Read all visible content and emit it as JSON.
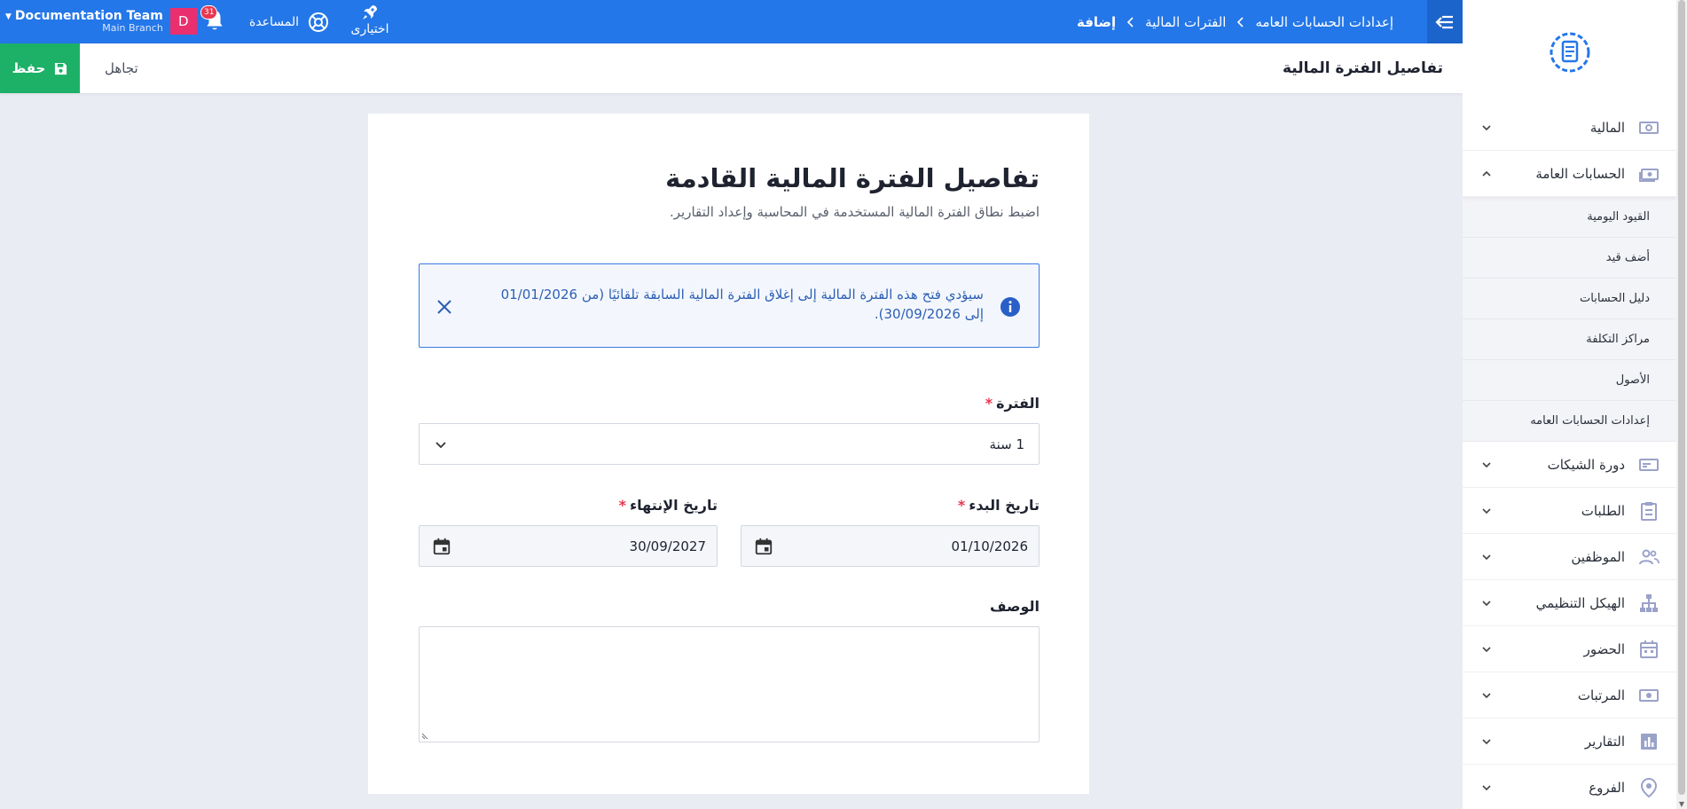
{
  "topbar": {
    "breadcrumb": [
      "إعدادات الحسابات العامه",
      "الفترات المالية",
      "إضافة"
    ],
    "shortcuts_label": "اختيارى",
    "help_label": "المساعدة",
    "notifications_count": "31",
    "user": {
      "team": "Documentation Team",
      "branch": "Main Branch",
      "avatar_letter": "D"
    }
  },
  "page": {
    "title": "تفاصيل الفترة المالية",
    "save_label": "حفظ",
    "cancel_label": "تجاهل"
  },
  "form": {
    "title": "تفاصيل الفترة المالية القادمة",
    "subtitle": "اضبط نطاق الفترة المالية المستخدمة في المحاسبة وإعداد التقارير.",
    "alert_text": "سيؤدي فتح هذه الفترة المالية إلى إغلاق الفترة المالية السابقة تلقائيًا (من 01/01/2026 إلى 30/09/2026).",
    "period_label": "الفترة",
    "period_value": "1 سنة",
    "start_label": "تاريخ البدء",
    "start_value": "01/10/2026",
    "end_label": "تاريخ الإنتهاء",
    "end_value": "30/09/2027",
    "description_label": "الوصف",
    "description_value": "",
    "required_mark": "*"
  },
  "sidebar": {
    "items": [
      {
        "label": "المالية",
        "icon": "money-icon"
      },
      {
        "label": "الحسابات العامة",
        "icon": "accounts-icon",
        "open": true
      },
      {
        "label": "دورة الشيكات",
        "icon": "cheque-icon"
      },
      {
        "label": "الطلبات",
        "icon": "clipboard-icon"
      },
      {
        "label": "الموظفين",
        "icon": "people-icon"
      },
      {
        "label": "الهيكل التنظيمي",
        "icon": "org-chart-icon"
      },
      {
        "label": "الحضور",
        "icon": "calendar-icon"
      },
      {
        "label": "المرتبات",
        "icon": "payroll-icon"
      },
      {
        "label": "التقارير",
        "icon": "bar-chart-icon"
      },
      {
        "label": "الفروع",
        "icon": "location-pin-icon"
      }
    ],
    "subitems": [
      "القيود اليومية",
      "أضف قيد",
      "دليل الحسابات",
      "مراكز التكلفة",
      "الأصول",
      "إعدادات الحسابات العامه"
    ]
  },
  "colors": {
    "primary": "#2477e8",
    "save": "#1db067",
    "required": "#e8374f",
    "alert_border": "#3b7be0",
    "badge": "#e8374f",
    "avatar": "#ea2f6f"
  }
}
